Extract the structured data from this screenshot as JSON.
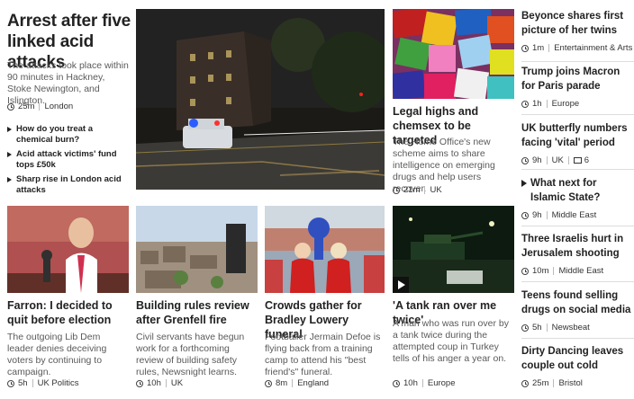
{
  "lead": {
    "headline": "Arrest after five linked acid attacks",
    "summary": "The attacks took place within 90 minutes in Hackney, Stoke Newington, and Islington.",
    "time": "25m",
    "section": "London",
    "related": [
      "How do you treat a chemical burn?",
      "Acid attack victims' fund tops £50k",
      "Sharp rise in London acid attacks"
    ]
  },
  "legal_highs": {
    "headline": "Legal highs and chemsex to be targeted",
    "summary": "The Home Office's new scheme aims to share intelligence on emerging drugs and help users recover.",
    "time": "21m",
    "section": "UK"
  },
  "sidebar": [
    {
      "headline": "Beyonce shares first picture of her twins",
      "time": "1m",
      "section": "Entertainment & Arts"
    },
    {
      "headline": "Trump joins Macron for Paris parade",
      "time": "1h",
      "section": "Europe"
    },
    {
      "headline": "UK butterfly numbers facing 'vital' period",
      "time": "9h",
      "section": "UK",
      "comments": "6"
    },
    {
      "headline": "What next for Islamic State?",
      "time": "9h",
      "section": "Middle East"
    },
    {
      "headline": "Three Israelis hurt in Jerusalem shooting",
      "time": "10m",
      "section": "Middle East"
    },
    {
      "headline": "Teens found selling drugs on social media",
      "time": "5h",
      "section": "Newsbeat"
    },
    {
      "headline": "Dirty Dancing leaves couple out cold",
      "time": "25m",
      "section": "Bristol"
    }
  ],
  "bottom": [
    {
      "headline": "Farron: I decided to quit before election",
      "summary": "The outgoing Lib Dem leader denies deceiving voters by continuing to campaign.",
      "time": "5h",
      "section": "UK Politics"
    },
    {
      "headline": "Building rules review after Grenfell fire",
      "summary": "Civil servants have begun work for a forthcoming review of building safety rules, Newsnight learns.",
      "time": "10h",
      "section": "UK"
    },
    {
      "headline": "Crowds gather for Bradley Lowery funeral",
      "summary": "Footballer Jermain Defoe is flying back from a training camp to attend his \"best friend's\" funeral.",
      "time": "8m",
      "section": "England"
    },
    {
      "headline": "'A tank ran over me twice'",
      "summary": "A man who was run over by a tank twice during the attempted coup in Turkey tells of his anger a year on.",
      "time": "10h",
      "section": "Europe"
    }
  ]
}
